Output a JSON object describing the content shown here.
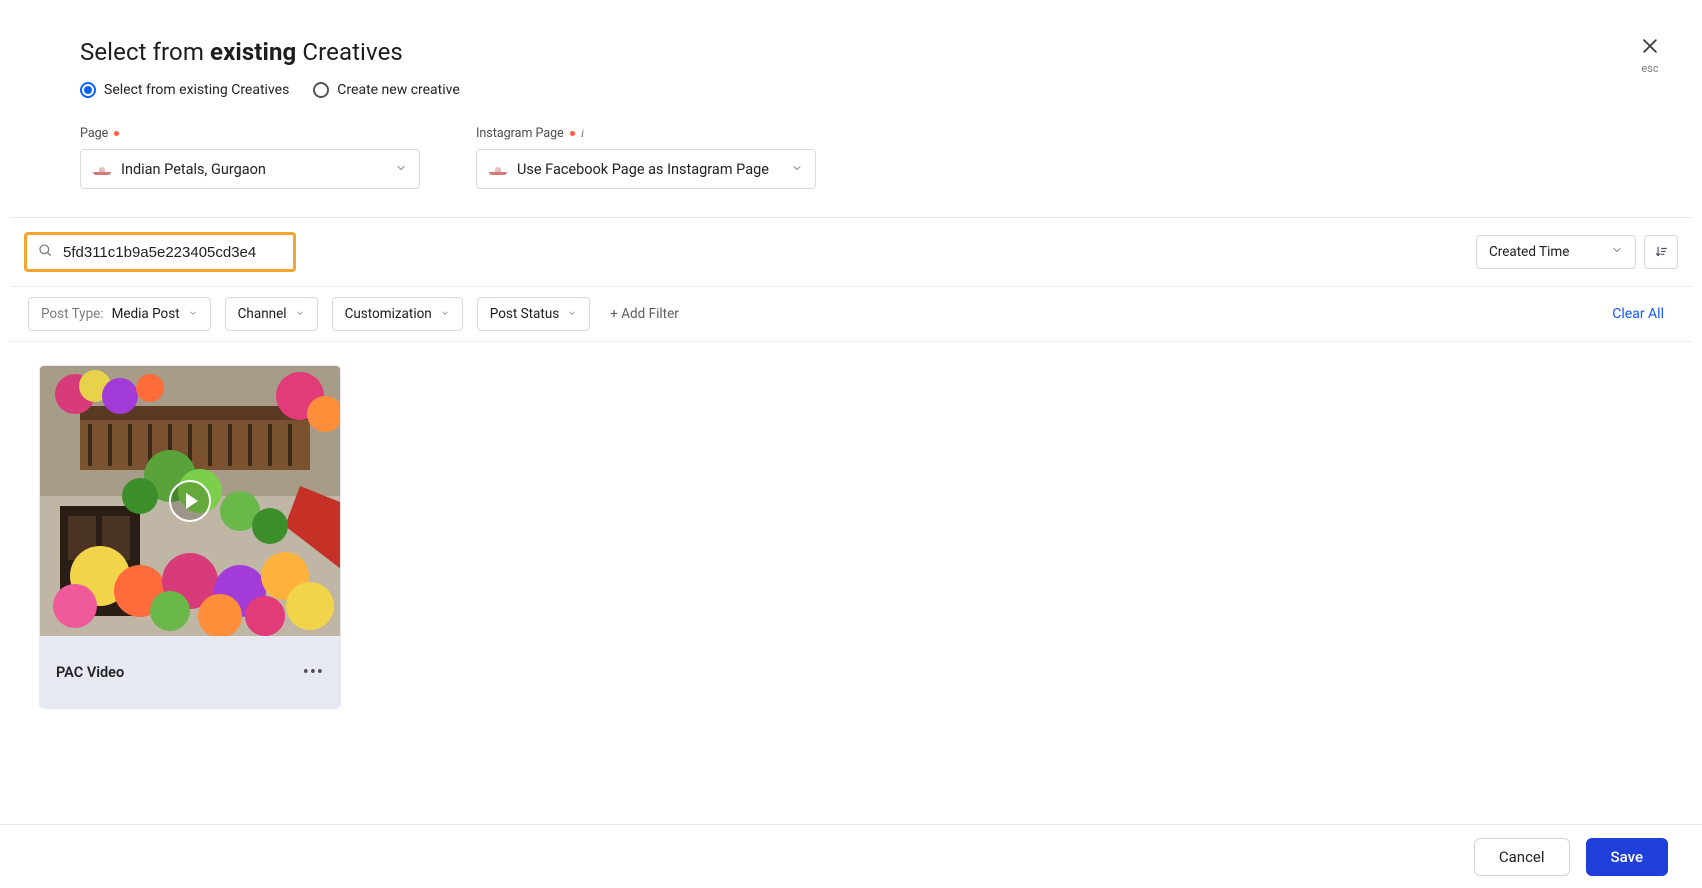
{
  "header": {
    "title_pre": "Select from ",
    "title_strong": "existing",
    "title_post": " Creatives",
    "esc_label": "esc"
  },
  "radio": {
    "existing": "Select from existing Creatives",
    "create": "Create new creative"
  },
  "page_field": {
    "label": "Page",
    "value": "Indian Petals, Gurgaon"
  },
  "ig_field": {
    "label": "Instagram Page",
    "value": "Use Facebook Page as Instagram Page"
  },
  "search": {
    "value": "5fd311c1b9a5e223405cd3e4"
  },
  "sort": {
    "label": "Created Time"
  },
  "filters": {
    "post_type_label": "Post Type:",
    "post_type_value": "Media Post",
    "channel": "Channel",
    "customization": "Customization",
    "post_status": "Post Status",
    "add_filter": "+ Add Filter",
    "clear_all": "Clear All"
  },
  "cards": [
    {
      "name": "PAC Video"
    }
  ],
  "footer": {
    "cancel": "Cancel",
    "save": "Save"
  }
}
